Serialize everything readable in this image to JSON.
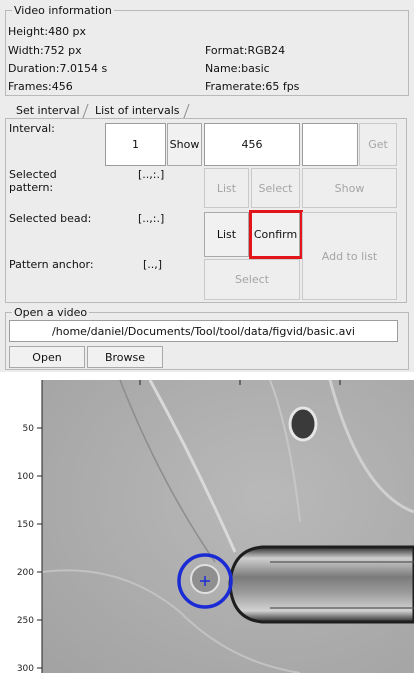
{
  "video_info": {
    "title": "Video information",
    "height": "Height:480 px",
    "width": "Width:752 px",
    "format": "Format:RGB24",
    "duration": "Duration:7.0154 s",
    "name": "Name:basic",
    "frames": "Frames:456",
    "framerate": "Framerate:65 fps"
  },
  "tabs": [
    {
      "label": "Set interval",
      "active": true
    },
    {
      "label": "List of intervals",
      "active": false
    }
  ],
  "interval": {
    "label": "Interval:",
    "start": "1",
    "show_label": "Show",
    "end": "456",
    "extra": "",
    "get_label": "Get"
  },
  "pattern": {
    "label": "Selected pattern:",
    "value": "[..,:.]",
    "list_label": "List",
    "select_label": "Select",
    "show_label": "Show"
  },
  "bead": {
    "label": "Selected bead:",
    "value": "[..,:.]",
    "list_label": "List",
    "confirm_label": "Confirm",
    "add_label": "Add to list"
  },
  "anchor": {
    "label": "Pattern anchor:",
    "value": "[..,]",
    "select_label": "Select"
  },
  "open_video": {
    "title": "Open a video",
    "path": "/home/daniel/Documents/Tool/tool/data/figvid/basic.avi",
    "open_label": "Open",
    "browse_label": "Browse"
  },
  "viewer": {
    "y_ticks": [
      "50",
      "100",
      "150",
      "200",
      "250",
      "300"
    ],
    "marker_color": "#1a2bd6"
  }
}
